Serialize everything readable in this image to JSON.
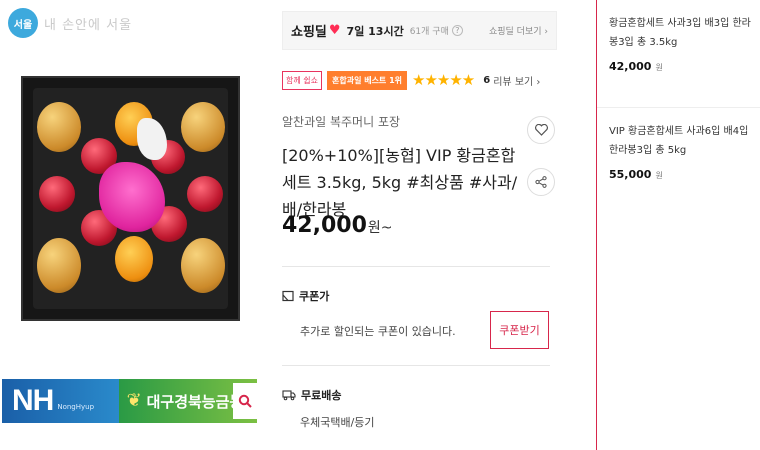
{
  "watermark": {
    "logo_text": "서울",
    "text": "내 손안에 서울"
  },
  "banner": {
    "nh_logo": "NH",
    "nh_sub": "NongHyup",
    "coop_name": "대구경북능금농협"
  },
  "live": {
    "brand": "쇼핑딜",
    "time": "7일 13시간",
    "buyers": "61개 구매",
    "more": "쇼핑딜 더보기 ›"
  },
  "badges": {
    "pink": "함께 쉽쇼",
    "orange": "혼합과일 베스트 1위"
  },
  "rating": {
    "stars": "★★★★★",
    "review_count": "6",
    "review_label": "리뷰 보기 ›"
  },
  "product": {
    "seller": "알찬과일 복주머니 포장",
    "title": "[20%+10%][농협] VIP 황금혼합세트 3.5kg, 5kg #최상품 #사과/배/한라봉",
    "price": "42,000",
    "price_unit": "원~"
  },
  "coupon": {
    "label": "쿠폰가",
    "description": "추가로 할인되는 쿠폰이 있습니다.",
    "button": "쿠폰받기"
  },
  "shipping": {
    "label": "무료배송",
    "method": "우체국택배/등기"
  },
  "options": [
    {
      "name": "황금혼합세트 사과3입 배3입 한라봉3입 총 3.5kg",
      "price": "42,000",
      "unit": "원"
    },
    {
      "name": "VIP 황금혼합세트 사과6입 배4입 한라봉3입 총 5kg",
      "price": "55,000",
      "unit": "원"
    }
  ],
  "colors": {
    "accent": "#d7264b",
    "badge_orange": "#ff7e2d",
    "star": "#ffb300",
    "nh_blue": "#1a5fa8",
    "nh_green": "#2a9a45"
  }
}
